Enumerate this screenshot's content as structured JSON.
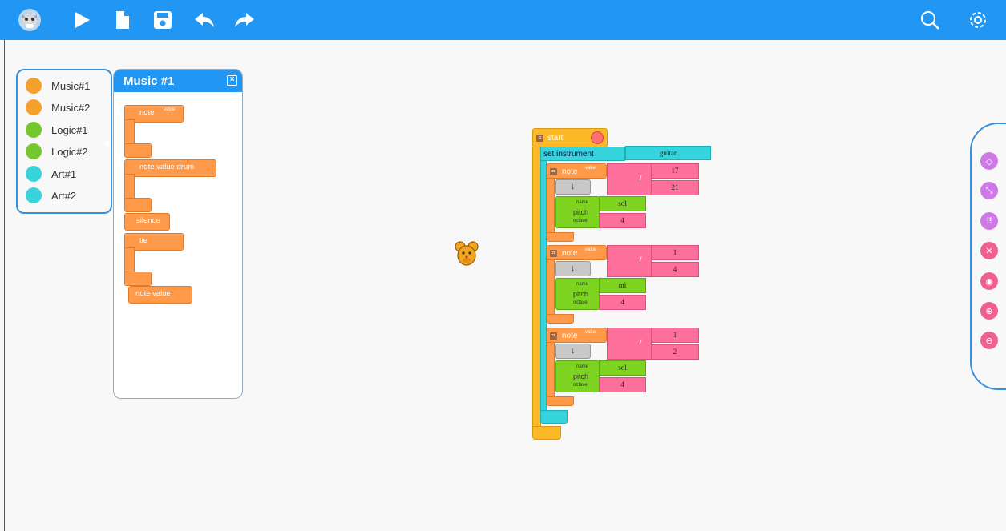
{
  "colors": {
    "topbar": "#2196f3",
    "music": "#f6a02c",
    "logic": "#74c72e",
    "art": "#39d3db",
    "purple_btn": "#cf78e8",
    "pink_btn": "#f0608e"
  },
  "toolbar": {
    "icons": [
      "mascot-logo-icon",
      "play-icon",
      "new-file-icon",
      "save-icon",
      "undo-icon",
      "redo-icon",
      "search-icon",
      "settings-icon"
    ]
  },
  "palette": {
    "items": [
      {
        "label": "Music#1"
      },
      {
        "label": "Music#2"
      },
      {
        "label": "Logic#1"
      },
      {
        "label": "Logic#2"
      },
      {
        "label": "Art#1"
      },
      {
        "label": "Art#2"
      }
    ]
  },
  "flyout": {
    "title": "Music #1",
    "blocks": {
      "note": "note",
      "note_value_label": "value",
      "note_value_drum": "note value drum",
      "silence": "silence",
      "tie": "tie",
      "note_value": "note value"
    }
  },
  "program": {
    "start": "start",
    "set_instrument": "set instrument",
    "instrument": "guitar",
    "divide_symbol": "/",
    "arrow": "↓",
    "note_label": "note",
    "value_label": "value",
    "pitch_label": "pitch",
    "name_label": "name",
    "octave_label": "octave",
    "notes": [
      {
        "num": "17",
        "den": "21",
        "name": "sol",
        "octave": "4"
      },
      {
        "num": "1",
        "den": "4",
        "name": "mi",
        "octave": "4"
      },
      {
        "num": "1",
        "den": "2",
        "name": "sol",
        "octave": "4"
      }
    ]
  },
  "right_tools": [
    "eraser-icon",
    "collapse-icon",
    "grid-icon",
    "shrink-icon",
    "eye-icon",
    "zoom-in-icon",
    "zoom-out-icon"
  ]
}
